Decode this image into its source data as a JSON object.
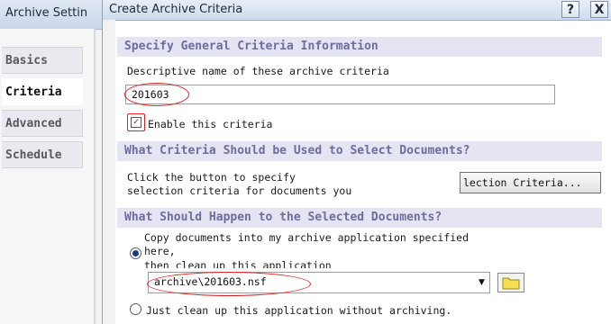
{
  "background_window": {
    "title": "Archive Settin",
    "tabs": [
      "Basics",
      "Criteria",
      "Advanced",
      "Schedule"
    ]
  },
  "dialog": {
    "title": "Create Archive Criteria",
    "help_button": "?",
    "close_button": "X",
    "section1": {
      "heading": "Specify General Criteria Information",
      "name_label": "Descriptive name of these archive criteria",
      "name_value": "201603",
      "enable_label": "Enable this criteria",
      "enable_checked": true
    },
    "section2": {
      "heading": "What Criteria Should be Used to Select Documents?",
      "desc_line1": "Click the button to specify",
      "desc_line2": "selection criteria for documents you",
      "button_label": "lection Criteria..."
    },
    "section3": {
      "heading": "What Should Happen to the Selected Documents?",
      "option1_line1": "Copy documents into my archive application specified",
      "option1_line2": "here,",
      "option1_line3": "then clean up this application",
      "archive_path": "archive\\201603.nsf",
      "option2_label": "Just clean up this application without archiving."
    }
  }
}
